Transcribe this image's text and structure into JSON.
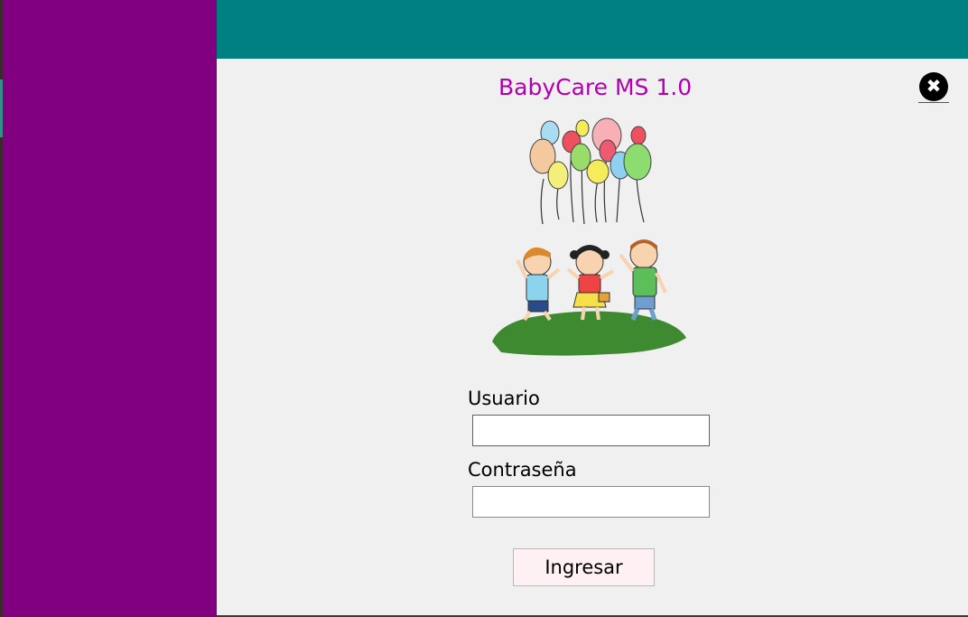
{
  "app": {
    "title": "BabyCare MS 1.0"
  },
  "close": {
    "icon": "close-icon",
    "glyph": "✖"
  },
  "login": {
    "user_label": "Usuario",
    "user_value": "",
    "password_label": "Contraseña",
    "password_value": "",
    "submit_label": "Ingresar"
  },
  "colors": {
    "sidebar": "#800080",
    "topbar": "#008080",
    "title": "#b000b0",
    "background": "#f0f0f0",
    "button": "#fff0f3"
  },
  "illustration": {
    "icon": "kids-balloons-illustration"
  }
}
